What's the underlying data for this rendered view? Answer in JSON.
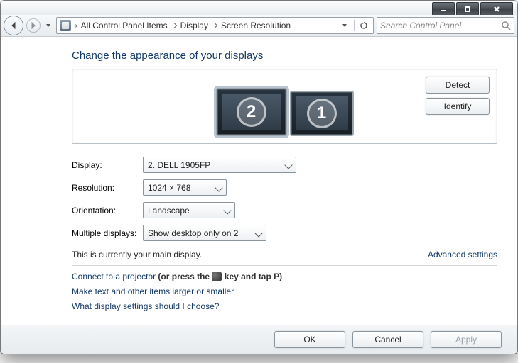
{
  "crumbs": {
    "prefix_icon": "double-chevron-left",
    "item1": "All Control Panel Items",
    "item2": "Display",
    "item3": "Screen Resolution"
  },
  "search": {
    "placeholder": "Search Control Panel"
  },
  "page": {
    "title": "Change the appearance of your displays"
  },
  "preview": {
    "monitors": [
      {
        "id": 2,
        "label": "2",
        "primary": true
      },
      {
        "id": 1,
        "label": "1",
        "primary": false
      }
    ],
    "detect": "Detect",
    "identify": "Identify"
  },
  "settings": {
    "display_label": "Display:",
    "display_value": "2. DELL 1905FP",
    "resolution_label": "Resolution:",
    "resolution_value": "1024 × 768",
    "orientation_label": "Orientation:",
    "orientation_value": "Landscape",
    "multi_label": "Multiple displays:",
    "multi_value": "Show desktop only on 2"
  },
  "notes": {
    "main_display_note": "This is currently your main display.",
    "advanced_link": "Advanced settings",
    "projector_prefix": "Connect to a projector ",
    "projector_bold": "(or press the ",
    "projector_bold_tail": " key and tap P)",
    "text_size_link": "Make text and other items larger or smaller",
    "help_link": "What display settings should I choose?"
  },
  "footer": {
    "ok": "OK",
    "cancel": "Cancel",
    "apply": "Apply"
  }
}
